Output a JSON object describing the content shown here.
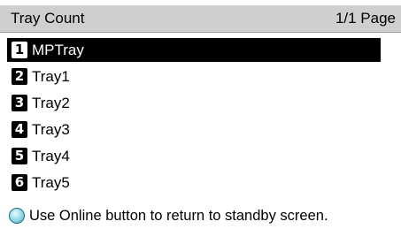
{
  "header": {
    "title": "Tray Count",
    "page": "1/1 Page"
  },
  "menu": {
    "items": [
      {
        "number": "1",
        "label": "MPTray",
        "selected": true
      },
      {
        "number": "2",
        "label": "Tray1",
        "selected": false
      },
      {
        "number": "3",
        "label": "Tray2",
        "selected": false
      },
      {
        "number": "4",
        "label": "Tray3",
        "selected": false
      },
      {
        "number": "5",
        "label": "Tray4",
        "selected": false
      },
      {
        "number": "6",
        "label": "Tray5",
        "selected": false
      }
    ]
  },
  "footer": {
    "icon": "online-button-icon",
    "message": "Use Online button to return to standby screen."
  },
  "colors": {
    "header_background": "#cfcfcf",
    "selected_background": "#000000",
    "selected_text": "#ffffff",
    "online_icon": "#5bbdd3"
  }
}
